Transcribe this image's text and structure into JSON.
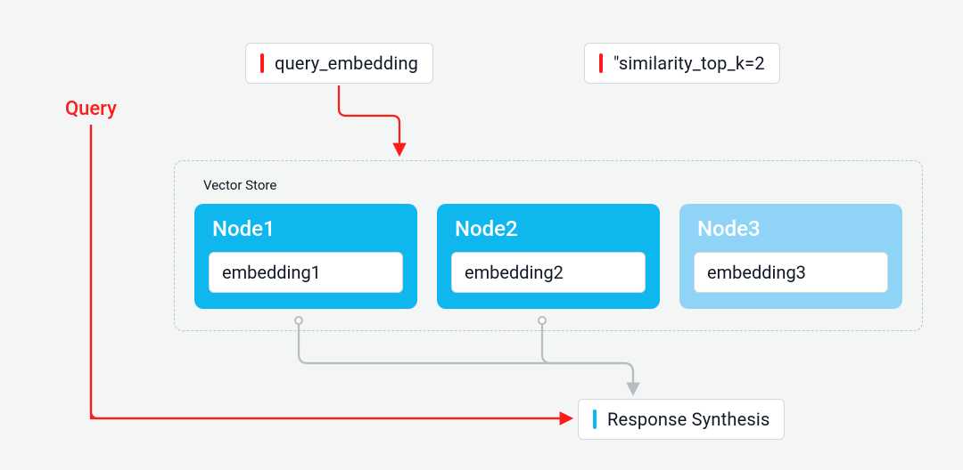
{
  "query_label": "Query",
  "input_boxes": {
    "query_embedding": "query_embedding",
    "similarity_top_k": "\"similarity_top_k=2"
  },
  "vector_store": {
    "title": "Vector Store",
    "nodes": [
      {
        "name": "Node1",
        "embedding": "embedding1",
        "selected": true
      },
      {
        "name": "Node2",
        "embedding": "embedding2",
        "selected": true
      },
      {
        "name": "Node3",
        "embedding": "embedding3",
        "selected": false
      }
    ]
  },
  "response_box": "Response Synthesis",
  "colors": {
    "accent_red": "#ff1b1b",
    "accent_blue": "#0fb7ef",
    "node_active": "#0fb7ef",
    "node_inactive": "#8fd4f7",
    "connector_gray": "#b9bcc2"
  }
}
